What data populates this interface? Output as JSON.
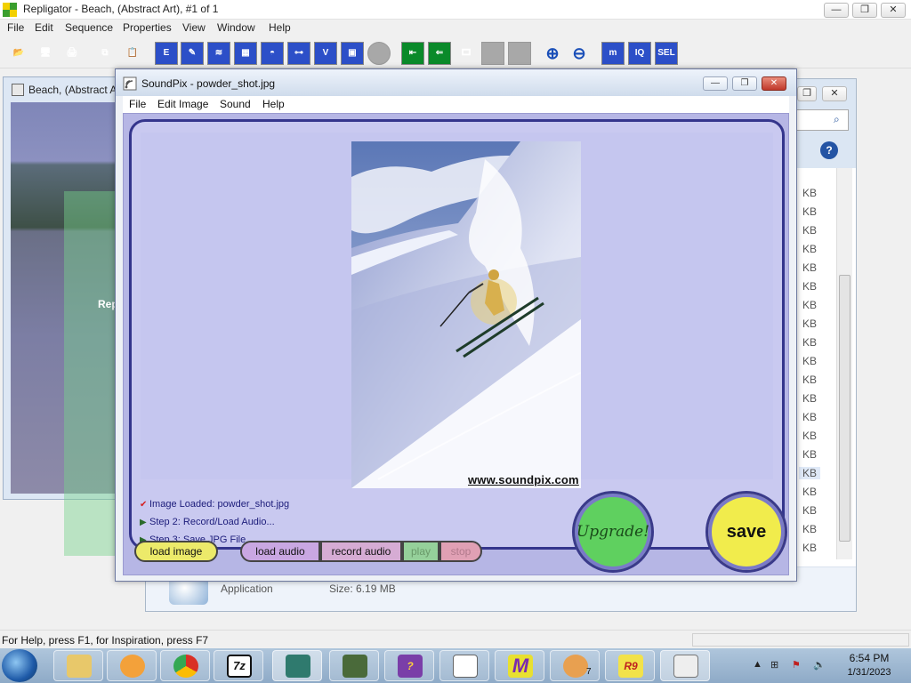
{
  "app": {
    "title": "Repligator - Beach, (Abstract Art), #1 of 1",
    "minimize": "—",
    "maximize": "❐",
    "close": "✕",
    "menu": [
      "File",
      "Edit",
      "Sequence",
      "Properties",
      "View",
      "Window",
      "Help"
    ]
  },
  "toolbar": {
    "labels": [
      "E",
      "V",
      "m",
      "IQ",
      "SEL"
    ]
  },
  "beach_window": {
    "title": "Beach, (Abstract A",
    "overlay_text": "Rep"
  },
  "explorer": {
    "kb_unit": "KB",
    "detail_type": "Application",
    "detail_size": "Size: 6.19 MB"
  },
  "soundpix": {
    "title": "SoundPix - powder_shot.jpg",
    "menu": [
      "File",
      "Edit Image",
      "Sound",
      "Help"
    ],
    "watermark": "www.soundpix.com",
    "steps": [
      {
        "mark": "✔",
        "text": "Image Loaded: powder_shot.jpg"
      },
      {
        "mark": "▶",
        "text": "Step 2: Record/Load Audio..."
      },
      {
        "mark": "▶",
        "text": "Step 3: Save JPG File..."
      }
    ],
    "buttons": {
      "load_image": "load image",
      "load_audio": "load audio",
      "record_audio": "record audio",
      "play": "play",
      "stop": "stop",
      "upgrade": "Upgrade!",
      "save": "save"
    }
  },
  "statusbar": {
    "text": "For Help, press F1, for Inspiration, press F7"
  },
  "taskbar": {
    "time": "6:54 PM",
    "date": "1/31/2023",
    "tray_badge": "7"
  },
  "colors": {
    "soundpix_panel": "#b6b6e5",
    "soundpix_frame": "#34358c",
    "upgrade": "#5fd05f",
    "save": "#f1ec4c"
  }
}
